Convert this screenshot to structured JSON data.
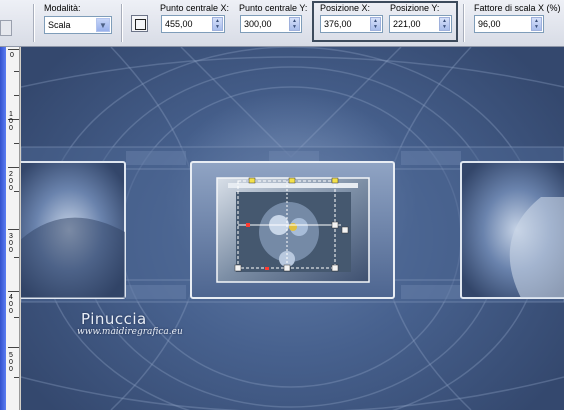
{
  "toolbar": {
    "mode": {
      "label": "Modalità:",
      "value": "Scala"
    },
    "center_x": {
      "label": "Punto centrale X:",
      "value": "455,00"
    },
    "center_y": {
      "label": "Punto centrale Y:",
      "value": "300,00"
    },
    "pos_x": {
      "label": "Posizione X:",
      "value": "376,00"
    },
    "pos_y": {
      "label": "Posizione Y:",
      "value": "221,00"
    },
    "scale_x": {
      "label": "Fattore di scala X (%)",
      "value": "96,00"
    }
  },
  "ruler": {
    "marks": [
      "0",
      "1 0 0",
      "2 0 0",
      "3 0 0",
      "4 0 0",
      "5 0 0"
    ]
  },
  "watermark": {
    "name": "Pinuccia",
    "url": "www.maidiregrafica.eu"
  },
  "colors": {
    "accent_frame": "#3d4b5c",
    "ruler_blue": "#2a4fd8",
    "canvas_base": "#47618e"
  }
}
